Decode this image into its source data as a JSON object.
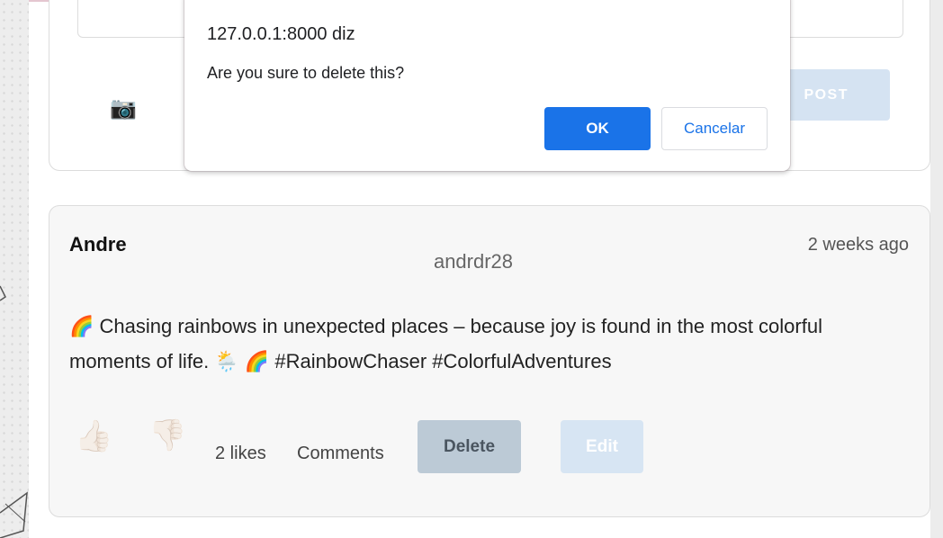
{
  "create_post": {
    "camera_icon": "📷",
    "post_button_label": "POST"
  },
  "post": {
    "author": "Andre",
    "username": "andrdr28",
    "timestamp": "2 weeks ago",
    "content": "🌈 Chasing rainbows in unexpected places – because joy is found in the most colorful moments of life. 🌦️ 🌈 #RainbowChaser #ColorfulAdventures",
    "like_icon": "👍🏻",
    "dislike_icon": "👎🏻",
    "likes": "2 likes",
    "comments_label": "Comments",
    "delete_label": "Delete",
    "edit_label": "Edit"
  },
  "dialog": {
    "origin": "127.0.0.1:8000 diz",
    "message": "Are you sure to delete this?",
    "ok_label": "OK",
    "cancel_label": "Cancelar"
  },
  "colors": {
    "primary": "#1a73e8",
    "delete_button": "#bccad6",
    "edit_button": "#d7e5f3",
    "post_button": "#d5e3f2"
  }
}
